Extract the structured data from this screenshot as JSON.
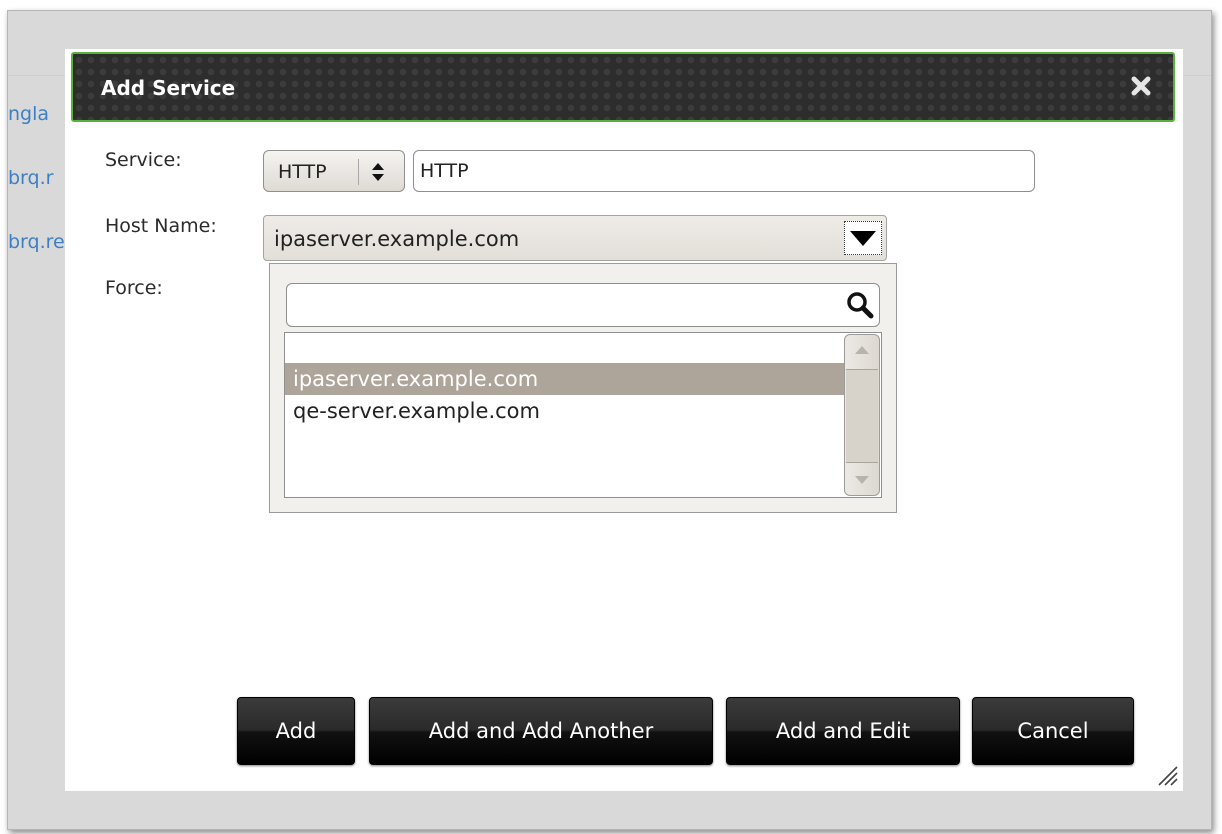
{
  "background": {
    "links": [
      "ngla",
      "brq.r",
      "brq.re"
    ]
  },
  "dialog": {
    "title": "Add Service",
    "close_icon": "close-icon",
    "service": {
      "label": "Service:",
      "protocol_value": "HTTP",
      "name_value": "HTTP"
    },
    "host": {
      "label": "Host Name:",
      "selected": "ipaserver.example.com",
      "search_value": "",
      "options": [
        "",
        "ipaserver.example.com",
        "qe-server.example.com"
      ],
      "selected_index": 1
    },
    "force": {
      "label": "Force:"
    },
    "buttons": {
      "add": "Add",
      "add_another": "Add and Add Another",
      "add_edit": "Add and Edit",
      "cancel": "Cancel"
    }
  },
  "colors": {
    "titlebar_border": "#57b13c",
    "link": "#3c7fc6",
    "selection": "#ada49a"
  }
}
